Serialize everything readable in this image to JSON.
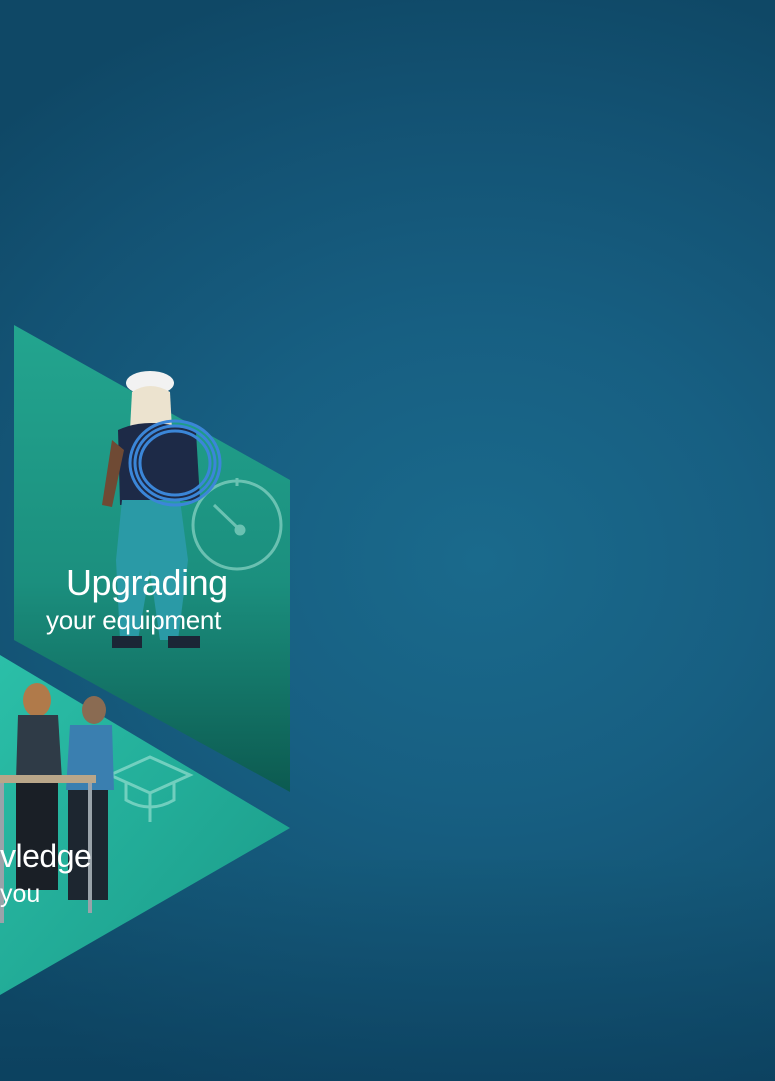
{
  "panel_upgrade": {
    "title": "Upgrading",
    "subtitle": "your equipment",
    "icon": "gauge-icon",
    "color": "#1e9a86"
  },
  "panel_knowledge": {
    "title": "vledge",
    "subtitle": "you",
    "icon": "graduation-cap-icon",
    "color": "#22b09a"
  },
  "background_color": "#175f82"
}
